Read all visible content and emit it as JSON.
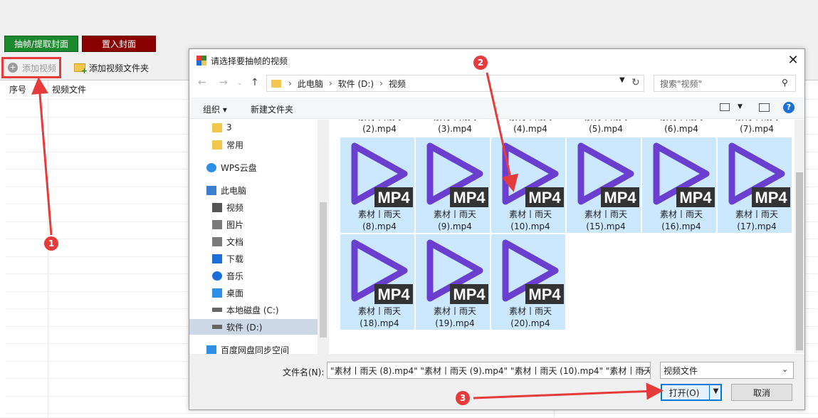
{
  "app": {
    "btn_extract": "抽帧/提取封面",
    "btn_cover": "置入封面",
    "btn_add_video": "添加视频",
    "btn_add_folder": "添加视频文件夹",
    "col_index": "序号",
    "col_file": "视频文件"
  },
  "dialog": {
    "title": "请选择要抽帧的视频",
    "breadcrumb": [
      "此电脑",
      "软件 (D:)",
      "视频"
    ],
    "search_placeholder": "搜索\"视频\"",
    "organize": "组织 ▾",
    "new_folder": "新建文件夹",
    "help": "?",
    "nav": [
      {
        "label": "3",
        "icon": "folder-icon"
      },
      {
        "label": "常用",
        "icon": "folder-icon"
      },
      {
        "label": "WPS云盘",
        "icon": "cloud-icon"
      },
      {
        "label": "此电脑",
        "icon": "computer-icon"
      },
      {
        "label": "视频",
        "icon": "video-icon"
      },
      {
        "label": "图片",
        "icon": "image-icon"
      },
      {
        "label": "文档",
        "icon": "document-icon"
      },
      {
        "label": "下载",
        "icon": "download-icon"
      },
      {
        "label": "音乐",
        "icon": "music-icon"
      },
      {
        "label": "桌面",
        "icon": "desktop-icon"
      },
      {
        "label": "本地磁盘 (C:)",
        "icon": "drive-icon"
      },
      {
        "label": "软件 (D:)",
        "icon": "drive-icon",
        "selected": true
      },
      {
        "label": "百度网盘同步空间",
        "icon": "baidu-icon"
      }
    ],
    "file_label_top": "素材丨雨天",
    "files_row1": [
      "(2).mp4",
      "(3).mp4",
      "(4).mp4",
      "(5).mp4",
      "(6).mp4",
      "(7).mp4"
    ],
    "files_row2": [
      "(8).mp4",
      "(9).mp4",
      "(10).mp4",
      "(15).mp4",
      "(16).mp4",
      "(17).mp4"
    ],
    "files_row3": [
      "(18).mp4",
      "(19).mp4",
      "(20).mp4"
    ],
    "badge_text": "MP4",
    "filename_label": "文件名(N):",
    "filename_value": "\"素材丨雨天 (8).mp4\" \"素材丨雨天 (9).mp4\" \"素材丨雨天 (10).mp4\" \"素材丨雨天",
    "filetype_value": "视频文件",
    "open_label": "打开(O)",
    "cancel_label": "取消"
  },
  "annotations": [
    "1",
    "2",
    "3"
  ],
  "colors": {
    "accent": "#0078d7",
    "annotation": "#e53b3b",
    "play_icon": "#6a3fd0",
    "extract": "#1b8a2e",
    "cover": "#8b0000"
  }
}
